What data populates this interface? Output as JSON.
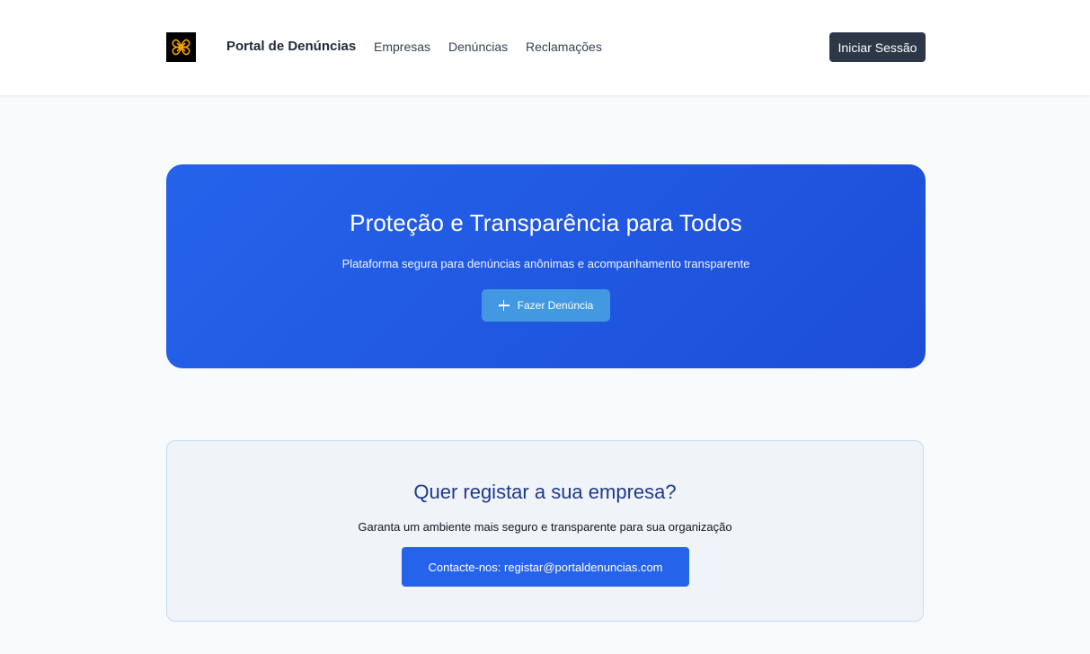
{
  "header": {
    "logo_icon": "celtic-knot-logo-icon",
    "brand": "Portal de Denúncias",
    "nav": [
      {
        "label": "Empresas"
      },
      {
        "label": "Denúncias"
      },
      {
        "label": "Reclamações"
      }
    ],
    "login_label": "Iniciar Sessão"
  },
  "hero": {
    "title": "Proteção e Transparência para Todos",
    "subtitle": "Plataforma segura para denúncias anônimas e acompanhamento transparente",
    "button_icon": "plus-icon",
    "button_label": "Fazer Denúncia"
  },
  "register": {
    "title": "Quer registar a sua empresa?",
    "subtitle": "Garanta um ambiente mais seguro e transparente para sua organização",
    "button_label": "Contacte-nos: registar@portaldenuncias.com"
  },
  "colors": {
    "primary": "#2563eb",
    "hero_gradient_end": "#1d4ed8",
    "report_button": "#4299e1",
    "login_button": "#2d3748",
    "logo_accent": "#f59e0b",
    "register_title": "#1e3a8a"
  }
}
